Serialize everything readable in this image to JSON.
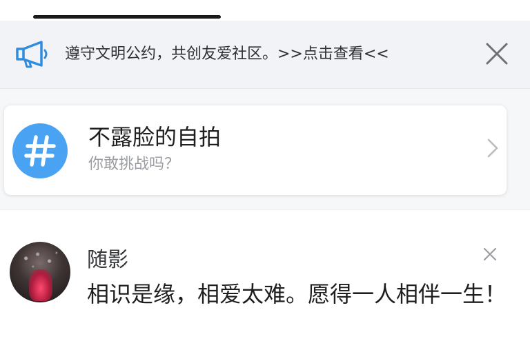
{
  "notice": {
    "text": "遵守文明公约，共创友爱社区。>>点击查看<<",
    "icon": "megaphone-icon",
    "close_icon": "close-icon",
    "accent_color": "#2f8de0"
  },
  "topic": {
    "icon": "hash-icon",
    "icon_color": "#4aa3f2",
    "title": "不露脸的自拍",
    "subtitle": "你敢挑战吗？",
    "chevron": "chevron-right-icon"
  },
  "post": {
    "username": "随影",
    "text": "相识是缘，相爱太难。愿得一人相伴一生！",
    "close_icon": "close-icon"
  }
}
